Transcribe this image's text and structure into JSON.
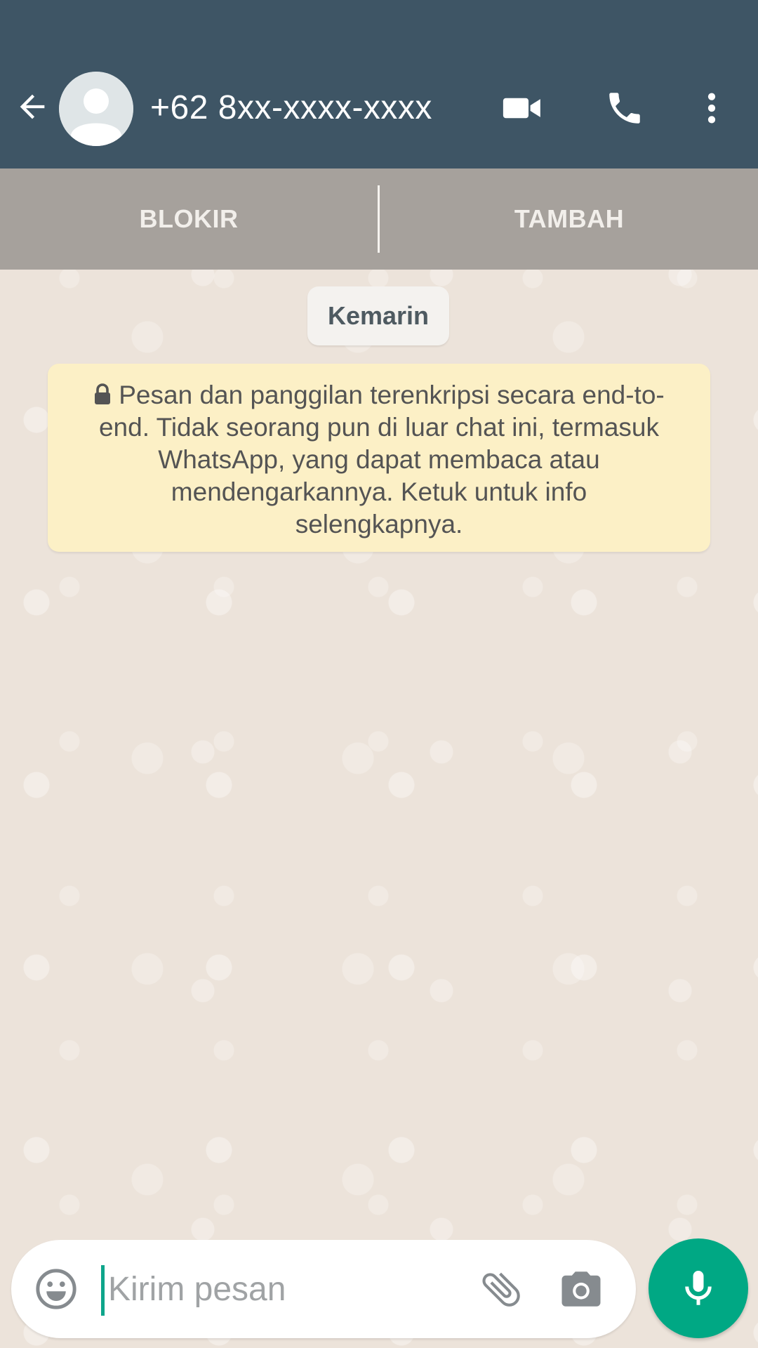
{
  "header": {
    "contact_name": "+62 8xx-xxxx-xxxx",
    "icons": {
      "back": "arrow-left-icon",
      "avatar": "default-avatar-icon",
      "video": "video-call-icon",
      "voice": "voice-call-icon",
      "menu": "more-vert-icon"
    },
    "background_color": "#3e5565"
  },
  "action_bar": {
    "block_label": "BLOKIR",
    "add_label": "TAMBAH"
  },
  "chat": {
    "date_label": "Kemarin",
    "encryption_notice": "Pesan dan panggilan terenkripsi secara end-to-end. Tidak seorang pun di luar chat ini, termasuk WhatsApp, yang dapat membaca atau mendengarkannya. Ketuk untuk info selengkapnya.",
    "notice_icon": "lock-icon",
    "notice_color": "#fcf0c6"
  },
  "composer": {
    "placeholder": "Kirim pesan",
    "value": "",
    "icons": {
      "emoji": "emoji-icon",
      "attach": "paperclip-icon",
      "camera": "camera-icon",
      "mic": "microphone-icon"
    },
    "accent_color": "#00a884"
  }
}
